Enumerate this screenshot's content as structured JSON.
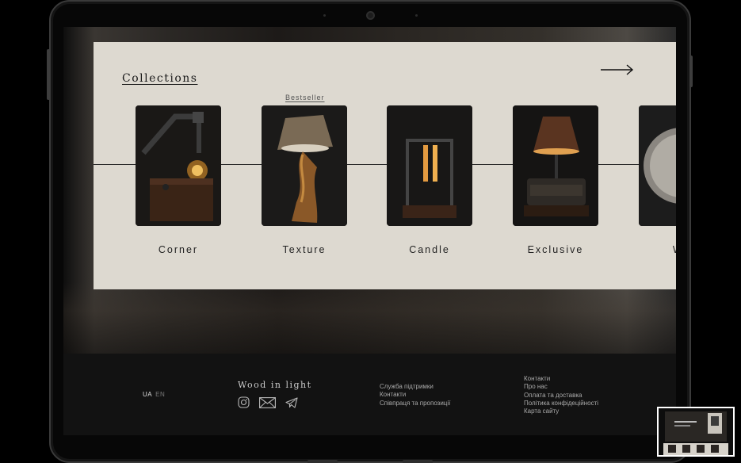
{
  "collections": {
    "title": "Collections",
    "bestseller_label": "Bestseller",
    "items": [
      {
        "name": "Corner"
      },
      {
        "name": "Texture"
      },
      {
        "name": "Candle"
      },
      {
        "name": "Exclusive"
      },
      {
        "name": "Wa"
      }
    ]
  },
  "footer": {
    "lang_ua": "UA",
    "lang_en": "EN",
    "brand": "Wood in light",
    "social_icons": [
      "instagram-icon",
      "mail-icon",
      "telegram-icon"
    ],
    "links_col1": [
      "Служба підтримки",
      "Контакти",
      "Співпраця та пропозиції"
    ],
    "links_col2": [
      "Контакти",
      "Про нас",
      "Оплата та доставка",
      "Політика конфідеційності",
      "Карта сайту"
    ]
  },
  "colors": {
    "panel_bg": "#ddd9d0",
    "footer_bg": "#121212",
    "text_dark": "#1a1a1a",
    "lang_active": "#e0e0e0",
    "lang_inactive": "#7a7a7a"
  }
}
